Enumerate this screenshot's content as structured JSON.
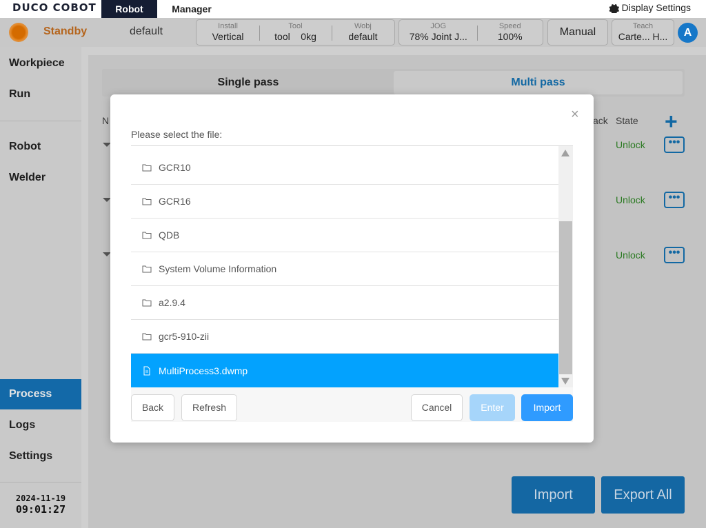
{
  "topbar": {
    "logo": "DUCO COBOT",
    "tabs": [
      "Robot",
      "Manager"
    ],
    "display_settings": "Display Settings"
  },
  "status": {
    "state": "Standby",
    "project": "default",
    "install": {
      "label": "Install",
      "value": "Vertical"
    },
    "tool": {
      "label": "Tool",
      "value": "tool",
      "mass": "0kg"
    },
    "wobj": {
      "label": "Wobj",
      "value": "default"
    },
    "jog": {
      "label": "JOG",
      "value": "78%  Joint J..."
    },
    "speed": {
      "label": "Speed",
      "value": "100%"
    },
    "mode": "Manual",
    "teach": {
      "label": "Teach",
      "value": "Carte... H..."
    },
    "user_initial": "A",
    "colors": {
      "standby": "#b5651d",
      "accent": "#1268a3"
    }
  },
  "sidebar": {
    "items": [
      "Workpiece",
      "Run",
      "Robot",
      "Welder",
      "Process",
      "Logs",
      "Settings"
    ],
    "active": "Process",
    "date": "2024-11-19",
    "time": "09:01:27"
  },
  "main": {
    "tabs": [
      "Single pass",
      "Multi pass"
    ],
    "active_tab": "Multi pass",
    "columns": {
      "name_partial": "N",
      "track_partial": "ack",
      "state": "State"
    },
    "rows": [
      {
        "state": "Unlock"
      },
      {
        "state": "Unlock"
      },
      {
        "state": "Unlock"
      }
    ],
    "more_label": "•••",
    "import_label": "Import",
    "export_all_label": "Export All"
  },
  "dialog": {
    "title": "Please select the file:",
    "close": "×",
    "files": [
      {
        "name": "GCR10",
        "type": "folder"
      },
      {
        "name": "GCR16",
        "type": "folder"
      },
      {
        "name": "QDB",
        "type": "folder"
      },
      {
        "name": "System Volume Information",
        "type": "folder"
      },
      {
        "name": "a2.9.4",
        "type": "folder"
      },
      {
        "name": "gcr5-910-zii",
        "type": "folder"
      },
      {
        "name": "MultiProcess3.dwmp",
        "type": "file",
        "selected": true
      }
    ],
    "buttons": {
      "back": "Back",
      "refresh": "Refresh",
      "cancel": "Cancel",
      "enter": "Enter",
      "import": "Import"
    },
    "colors": {
      "selected_row": "#03a2fe",
      "import_button": "#2f9bff",
      "enter_disabled": "#a6d5fa"
    }
  }
}
